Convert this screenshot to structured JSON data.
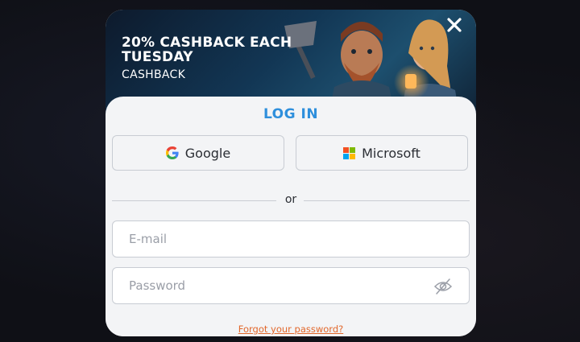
{
  "banner": {
    "title": "20% CASHBACK EACH TUESDAY",
    "subtitle": "CASHBACK"
  },
  "close_icon": "close-icon",
  "login": {
    "title": "LOG IN",
    "google_label": "Google",
    "microsoft_label": "Microsoft",
    "divider_text": "or",
    "email_placeholder": "E-mail",
    "password_placeholder": "Password",
    "forgot_label": "Forgot your password?"
  },
  "colors": {
    "accent_blue": "#2e8fdc",
    "link_orange": "#e2672b",
    "panel_bg": "#f3f4f6"
  }
}
